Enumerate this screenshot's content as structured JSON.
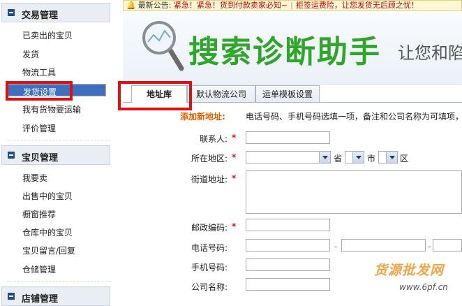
{
  "sidebar": {
    "sections": [
      {
        "title": "交易管理",
        "items": [
          "已卖出的宝贝",
          "发货",
          "物流工具",
          "发货设置",
          "我有货物要运输",
          "评价管理"
        ]
      },
      {
        "title": "宝贝管理",
        "items": [
          "我要卖",
          "出售中的宝贝",
          "橱窗推荐",
          "仓库中的宝贝",
          "宝贝留言/回复",
          "仓储管理"
        ]
      },
      {
        "title": "店铺管理"
      }
    ]
  },
  "notice": {
    "label": "最新公告:",
    "text": "紧急！紧急！货到付款卖家必知~",
    "text2": "拒签运费险，让您发货无后顾之忧！"
  },
  "banner": {
    "title": "搜索诊断助手",
    "subtitle": "让您和陷"
  },
  "tabs": [
    "地址库",
    "默认物流公司",
    "运单模板设置"
  ],
  "form": {
    "add_label": "添加新地址:",
    "add_hint": "电话号码、手机号码选填一项，备注和公司名称为可填项，",
    "contact_label": "联系人:",
    "region_label": "所在地区:",
    "province_unit": "省",
    "city_unit": "市",
    "district_unit": "区",
    "street_label": "街道地址:",
    "postcode_label": "邮政编码:",
    "phone_label": "电话号码:",
    "phone_sep": "-",
    "mobile_label": "手机号码:",
    "company_label": "公司名称:",
    "required_mark": "*"
  },
  "watermark": {
    "brand": "货源批发网",
    "url": "www.6pf.cn"
  },
  "colors": {
    "accent": "#3f6fc0",
    "highlight_box": "#e01010",
    "banner_green": "#2fa52a",
    "hint_orange": "#e06000"
  }
}
